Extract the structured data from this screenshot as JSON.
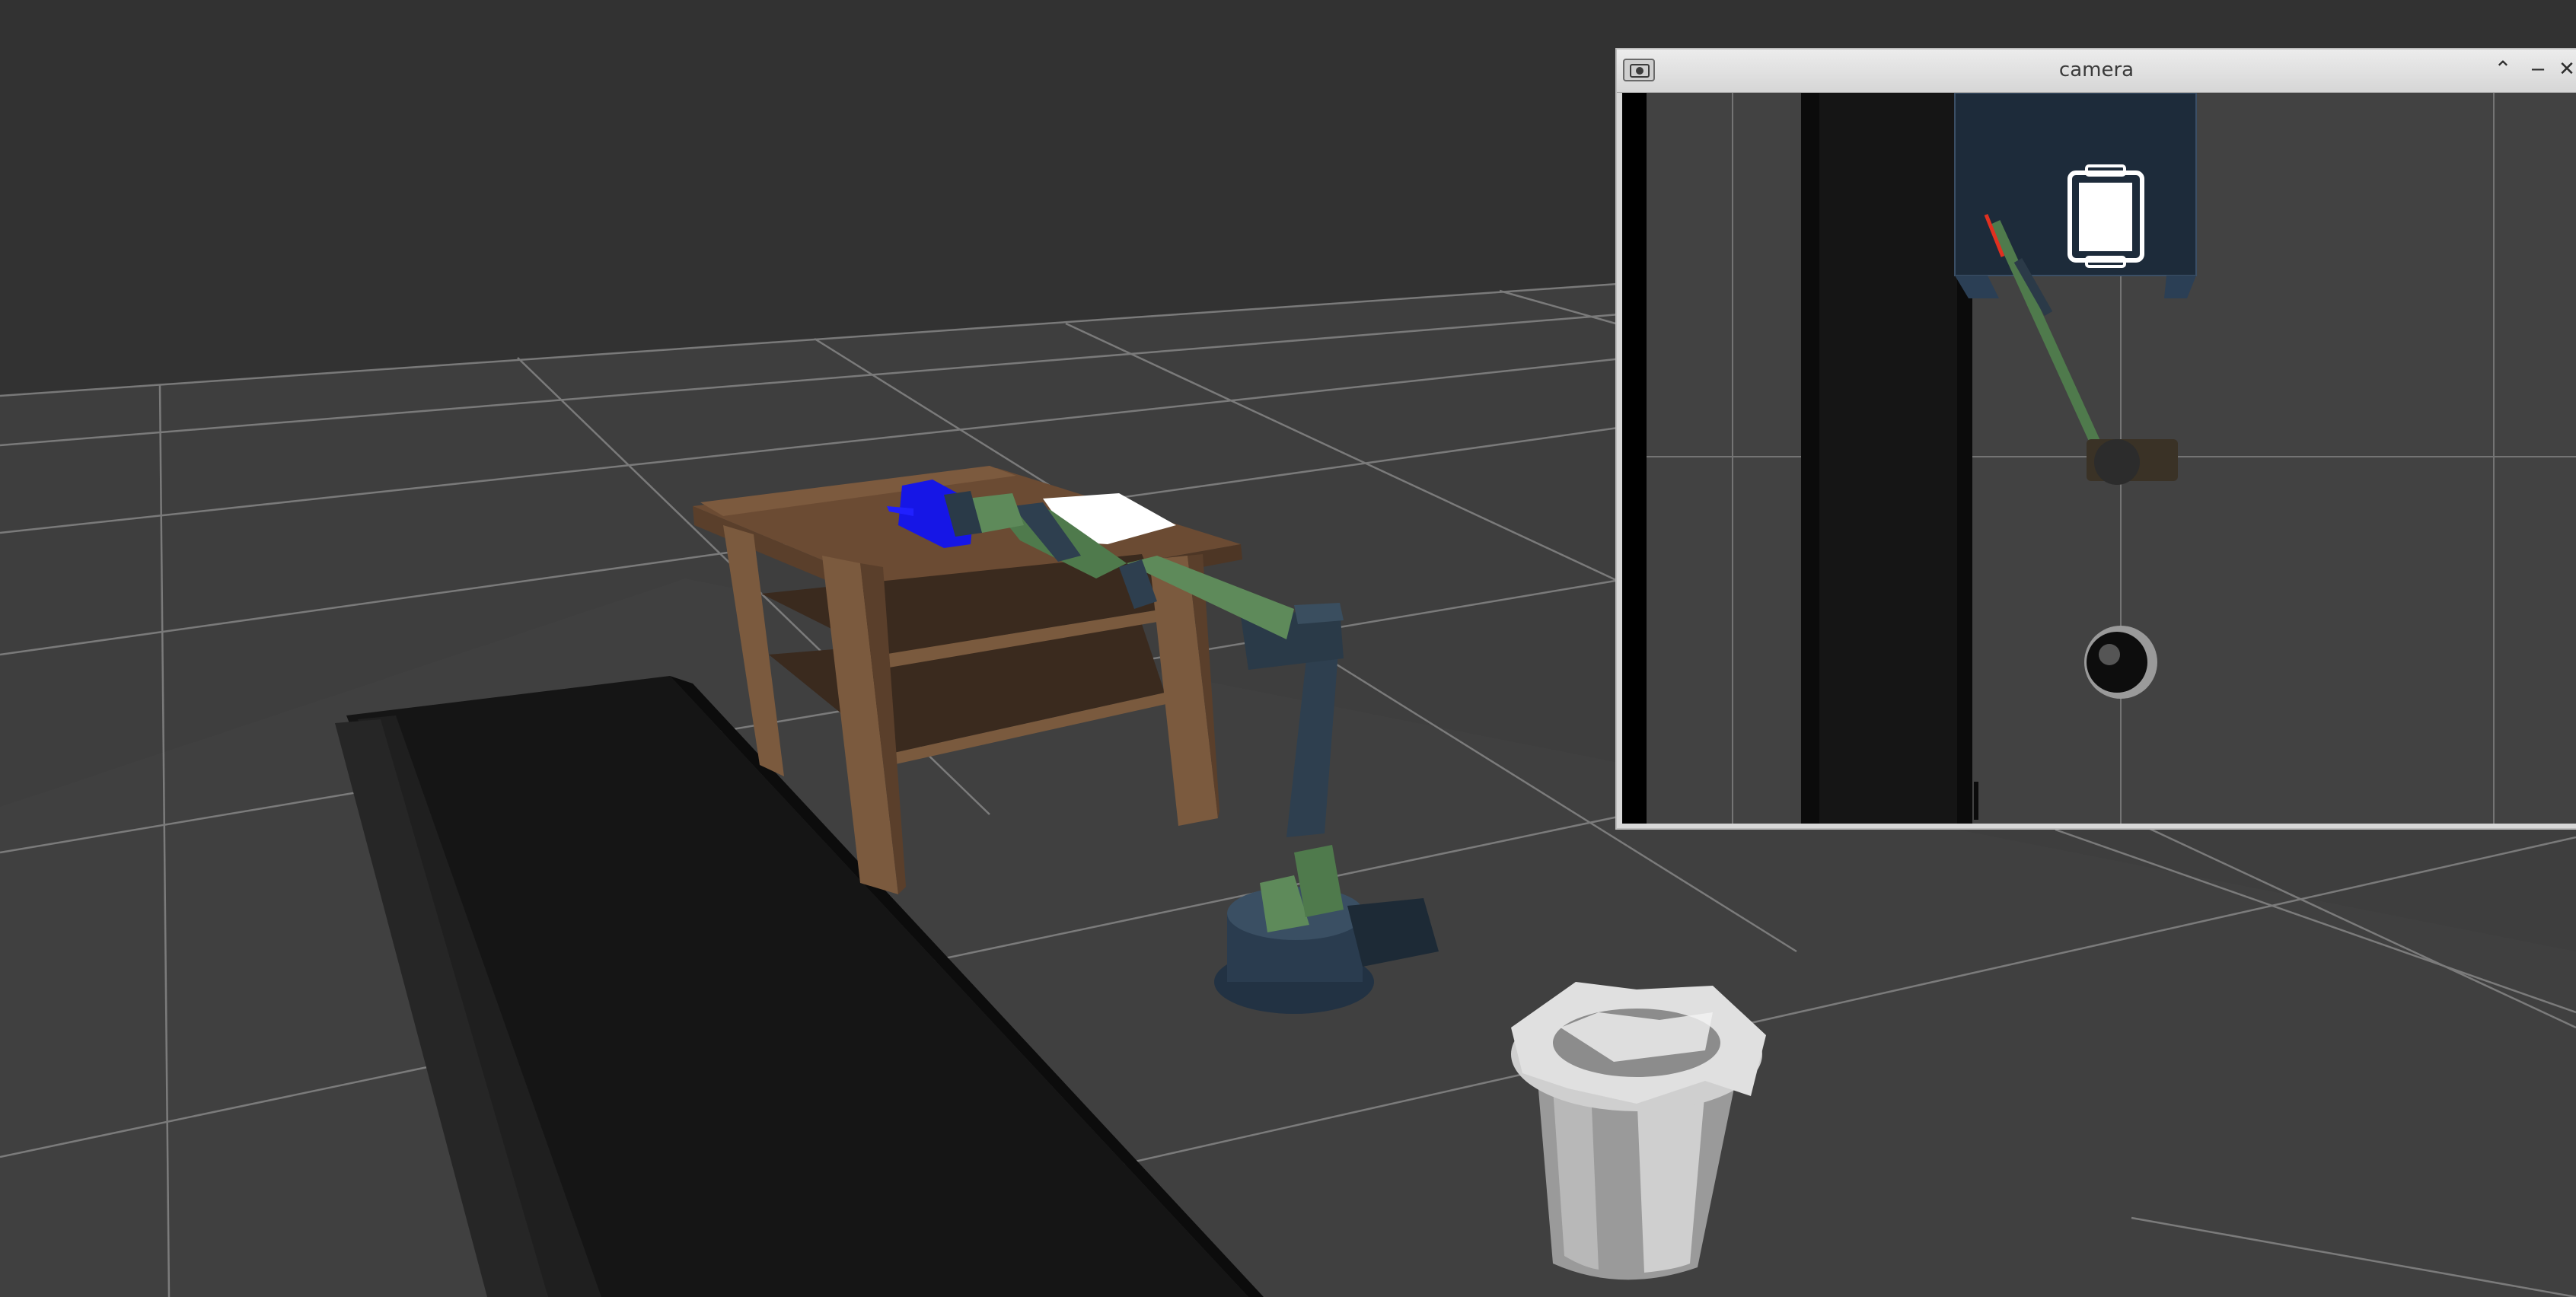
{
  "camera_window": {
    "title": "camera",
    "icons": {
      "menu": "window-menu-icon",
      "shade": "shade-up-icon",
      "minimize": "minimize-icon",
      "close": "close-icon"
    },
    "shade_glyph": "⌃",
    "minimize_glyph": "‒",
    "close_glyph": "✕"
  },
  "colors": {
    "floor": "#3f3f3f",
    "background": "#333333",
    "grid": "#9a9a9a",
    "table_wood": "#7a5a3e",
    "arm_green": "#5e8a5a",
    "arm_dark": "#2d3c48",
    "target_block": "#1313e0",
    "conveyor": "#161616"
  }
}
